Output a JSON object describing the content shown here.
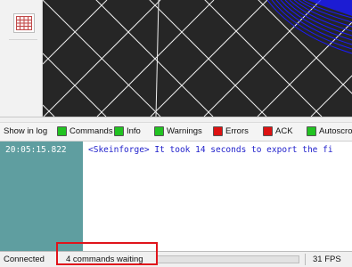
{
  "log_filters": {
    "show_label": "Show in log",
    "items": [
      {
        "label": "Commands",
        "color": "#22c322"
      },
      {
        "label": "Info",
        "color": "#22c322"
      },
      {
        "label": "Warnings",
        "color": "#22c322"
      },
      {
        "label": "Errors",
        "color": "#dd1111"
      },
      {
        "label": "ACK",
        "color": "#dd1111"
      },
      {
        "label": "Autoscro",
        "color": "#22c322"
      }
    ]
  },
  "log": {
    "entries": [
      {
        "timestamp": "20:05:15.822",
        "message": "<Skeinforge> It took 14 seconds to export the fi"
      }
    ]
  },
  "status": {
    "connection": "Connected",
    "queue": "4 commands waiting",
    "fps": "31 FPS"
  },
  "colors": {
    "viewport_bg": "#262626",
    "grid_lines": "#f0f0f0",
    "model": "#1a1aff",
    "log_timestamp_bg": "#5f9ea0",
    "highlight": "#e0141b"
  },
  "icons": {
    "grid_button": "grid-icon"
  }
}
